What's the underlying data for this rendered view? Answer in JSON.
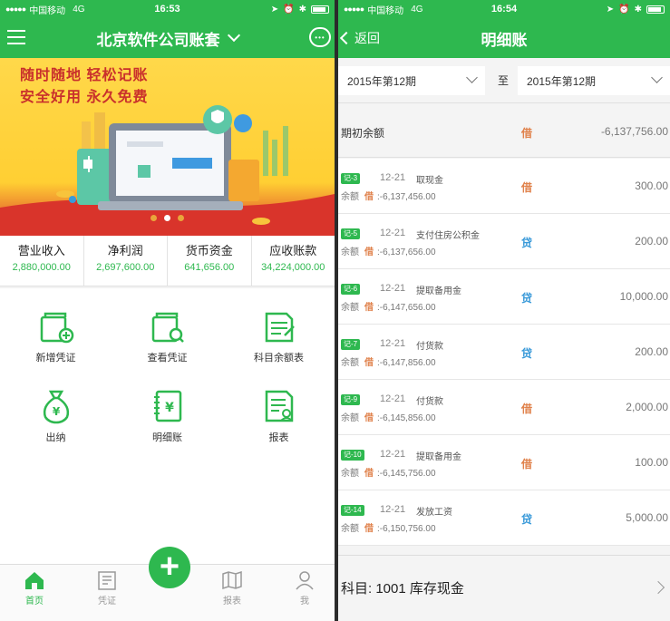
{
  "status_bar": {
    "left_screen": {
      "carrier": "中国移动",
      "network": "4G",
      "time": "16:53"
    },
    "right_screen": {
      "carrier": "中国移动",
      "network": "4G",
      "time": "16:54"
    }
  },
  "home": {
    "title": "北京软件公司账套",
    "chat_badge": "•••",
    "banner": {
      "line1": "随时随地  轻松记账",
      "line2": "安全好用  永久免费",
      "page_count": 3,
      "active_page": 1
    },
    "stats": [
      {
        "label": "营业收入",
        "value": "2,880,000.00"
      },
      {
        "label": "净利润",
        "value": "2,697,600.00"
      },
      {
        "label": "货币资金",
        "value": "641,656.00"
      },
      {
        "label": "应收账款",
        "value": "34,224,000.00"
      }
    ],
    "grid": [
      {
        "label": "新增凭证",
        "icon": "add-voucher-icon"
      },
      {
        "label": "查看凭证",
        "icon": "view-voucher-icon"
      },
      {
        "label": "科目余额表",
        "icon": "balance-sheet-icon"
      },
      {
        "label": "出纳",
        "icon": "money-bag-icon"
      },
      {
        "label": "明细账",
        "icon": "ledger-icon"
      },
      {
        "label": "报表",
        "icon": "report-icon"
      }
    ],
    "tabbar": [
      {
        "label": "首页",
        "icon": "home-icon",
        "active": true
      },
      {
        "label": "凭证",
        "icon": "voucher-icon",
        "active": false
      },
      {
        "label": "报表",
        "icon": "map-icon",
        "active": false
      },
      {
        "label": "我",
        "icon": "person-icon",
        "active": false
      }
    ],
    "fab_label": "+"
  },
  "ledger": {
    "back_label": "返回",
    "title": "明细账",
    "period_from": "2015年第12期",
    "to_label": "至",
    "period_to": "2015年第12期",
    "opening": {
      "label": "期初余额",
      "direction": "借",
      "amount": "-6,137,756.00"
    },
    "entries": [
      {
        "voucher": "记-3",
        "date": "12-21",
        "summary": "取现金",
        "balance_label": "余额",
        "balance_dir": "借",
        "balance": "-6,137,456.00",
        "direction": "借",
        "amount": "300.00"
      },
      {
        "voucher": "记-5",
        "date": "12-21",
        "summary": "支付住房公积金",
        "balance_label": "余额",
        "balance_dir": "借",
        "balance": "-6,137,656.00",
        "direction": "贷",
        "amount": "200.00"
      },
      {
        "voucher": "记-6",
        "date": "12-21",
        "summary": "提取备用金",
        "balance_label": "余额",
        "balance_dir": "借",
        "balance": "-6,147,656.00",
        "direction": "贷",
        "amount": "10,000.00"
      },
      {
        "voucher": "记-7",
        "date": "12-21",
        "summary": "付货款",
        "balance_label": "余额",
        "balance_dir": "借",
        "balance": "-6,147,856.00",
        "direction": "贷",
        "amount": "200.00"
      },
      {
        "voucher": "记-9",
        "date": "12-21",
        "summary": "付货款",
        "balance_label": "余额",
        "balance_dir": "借",
        "balance": "-6,145,856.00",
        "direction": "借",
        "amount": "2,000.00"
      },
      {
        "voucher": "记-10",
        "date": "12-21",
        "summary": "提取备用金",
        "balance_label": "余额",
        "balance_dir": "借",
        "balance": "-6,145,756.00",
        "direction": "借",
        "amount": "100.00"
      },
      {
        "voucher": "记-14",
        "date": "12-21",
        "summary": "发放工资",
        "balance_label": "余额",
        "balance_dir": "借",
        "balance": "-6,150,756.00",
        "direction": "贷",
        "amount": "5,000.00"
      }
    ],
    "subject": "科目:  1001 库存现金"
  },
  "colors": {
    "brand_green": "#2eb84f",
    "debit_orange": "#e0824c",
    "credit_blue": "#3a9ad9"
  }
}
